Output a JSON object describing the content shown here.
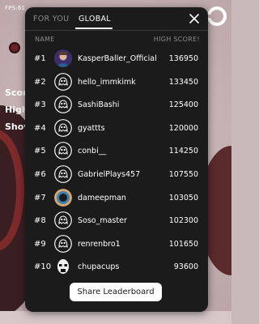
{
  "hud": {
    "fps": "FPS:61",
    "score_partial": "Scor",
    "high_partial": "High",
    "show_partial": "Shov"
  },
  "leaderboard": {
    "tabs": [
      {
        "label": "FOR YOU",
        "active": false
      },
      {
        "label": "GLOBAL",
        "active": true
      }
    ],
    "columns": {
      "name": "NAME",
      "score": "HIGH SCORE!"
    },
    "rows": [
      {
        "rank": "#1",
        "name": "KasperBaller_Official",
        "score": "136950",
        "avatar": "photo"
      },
      {
        "rank": "#2",
        "name": "hello_immkimk",
        "score": "133450",
        "avatar": "ghost"
      },
      {
        "rank": "#3",
        "name": "SashiBashi",
        "score": "125400",
        "avatar": "ghost"
      },
      {
        "rank": "#4",
        "name": "gyattts",
        "score": "120000",
        "avatar": "ghost"
      },
      {
        "rank": "#5",
        "name": "conbi__",
        "score": "114250",
        "avatar": "ghost"
      },
      {
        "rank": "#6",
        "name": "GabrielPlays457",
        "score": "107550",
        "avatar": "ghost"
      },
      {
        "rank": "#7",
        "name": "dameepman",
        "score": "103050",
        "avatar": "ring"
      },
      {
        "rank": "#8",
        "name": "Soso_master",
        "score": "102300",
        "avatar": "ghost"
      },
      {
        "rank": "#9",
        "name": "renrenbro1",
        "score": "101650",
        "avatar": "ghost"
      },
      {
        "rank": "#10",
        "name": "chupacups",
        "score": "93600",
        "avatar": "face"
      }
    ],
    "share_label": "Share Leaderboard",
    "close_icon": "close-icon"
  },
  "colors": {
    "panel": "#1c1b1c",
    "muted_text": "#8c8c8c",
    "button_bg": "#ffffff"
  }
}
